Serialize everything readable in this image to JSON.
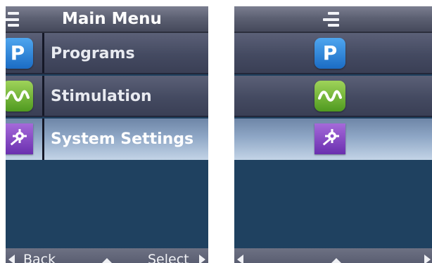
{
  "left_screen": {
    "header": {
      "title": "Main Menu",
      "menu_icon": "menu-list-icon"
    },
    "items": [
      {
        "label": "Programs",
        "icon": "programs-icon",
        "icon_letter": "P",
        "selected": false
      },
      {
        "label": "Stimulation",
        "icon": "stimulation-wave-icon",
        "selected": false
      },
      {
        "label": "System Settings",
        "icon": "system-settings-icon",
        "selected": true
      }
    ],
    "footer": {
      "back_label": "Back",
      "select_label": "Select"
    }
  },
  "right_screen": {
    "header": {
      "menu_icon": "menu-list-icon"
    },
    "items": [
      {
        "icon": "programs-icon",
        "icon_letter": "P",
        "selected": false
      },
      {
        "icon": "stimulation-wave-icon",
        "selected": false
      },
      {
        "icon": "system-settings-icon",
        "selected": true
      }
    ]
  },
  "colors": {
    "screen_background": "#1f4160",
    "row_background": "#444a61",
    "selected_row": "#a9bdd6",
    "programs_icon": "#2f86dd",
    "stimulation_icon": "#74b83a",
    "system_settings_icon": "#8b4cc8"
  }
}
